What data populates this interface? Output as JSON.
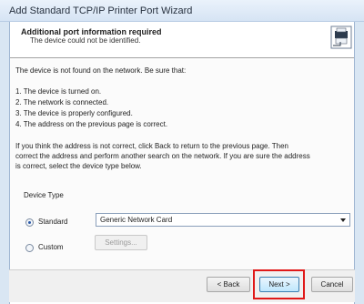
{
  "window": {
    "title": "Add Standard TCP/IP Printer Port Wizard"
  },
  "header": {
    "title": "Additional port information required",
    "subtitle": "The device could not be identified.",
    "icon": "printer-network-icon"
  },
  "content": {
    "intro": "The device is not found on the network.  Be sure that:",
    "checklist": [
      "1.  The device is turned on.",
      "2.  The network is connected.",
      "3.  The device is properly configured.",
      "4.  The address on the previous page is correct."
    ],
    "instructions": [
      "If you think the address is not correct, click Back to return to the previous page.  Then",
      "correct the address and perform another search on the network.  If you are sure the address",
      "is correct, select the device type below."
    ]
  },
  "device_type": {
    "legend": "Device Type",
    "standard": {
      "label": "Standard",
      "selected": true
    },
    "standard_value": "Generic Network Card",
    "custom": {
      "label": "Custom",
      "selected": false
    },
    "settings_label": "Settings..."
  },
  "buttons": {
    "back": "< Back",
    "next": "Next >",
    "cancel": "Cancel"
  },
  "colors": {
    "highlight": "#e01919"
  }
}
